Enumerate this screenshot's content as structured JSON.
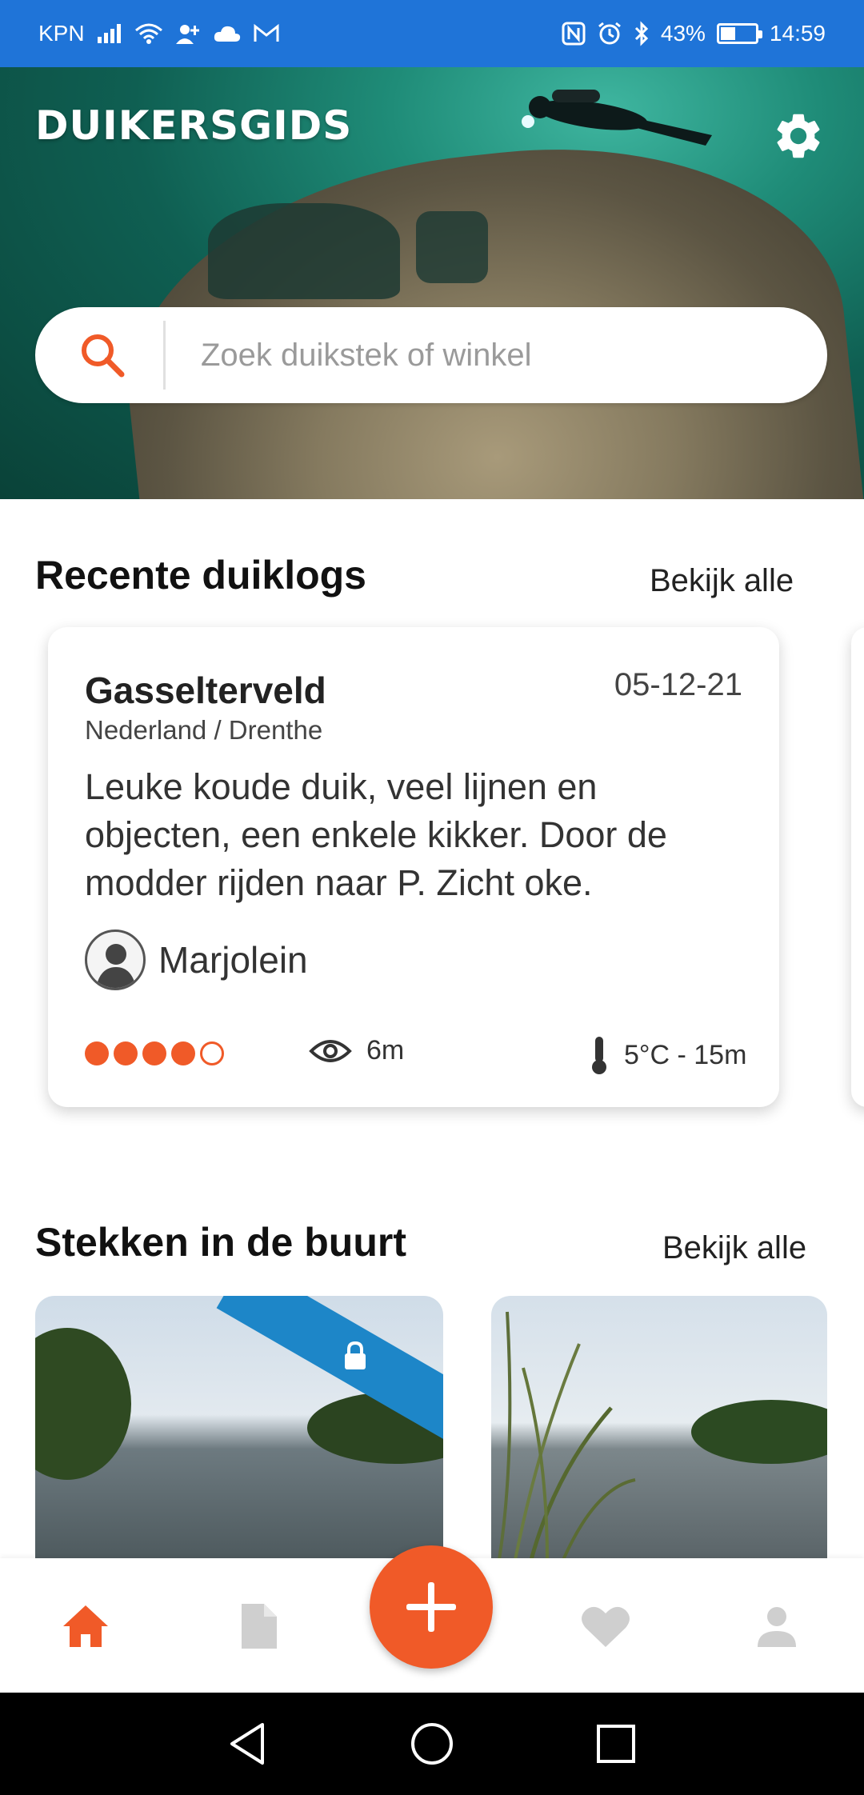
{
  "status_bar": {
    "carrier": "KPN",
    "battery_percent": "43%",
    "battery_level": 0.43,
    "time": "14:59"
  },
  "hero": {
    "brand": "DUIKERSGIDS",
    "search_placeholder": "Zoek duikstek of winkel"
  },
  "recent_logs": {
    "title": "Recente duiklogs",
    "view_all": "Bekijk alle",
    "card": {
      "site": "Gasselterveld",
      "date": "05-12-21",
      "location": "Nederland / Drenthe",
      "text": "Leuke koude duik, veel lijnen en objecten, een enkele kikker. Door de modder rijden naar P. Zicht oke.",
      "user": "Marjolein",
      "rating": 4,
      "rating_max": 5,
      "visibility": "6m",
      "temperature_depth": "5°C - 15m"
    }
  },
  "nearby": {
    "title": "Stekken in de buurt",
    "view_all": "Bekijk alle"
  },
  "colors": {
    "accent": "#f05a28",
    "status_bar": "#1f74d8",
    "ribbon": "#1d86c8"
  },
  "icons": {
    "nav": [
      "home-icon",
      "document-icon",
      "add-icon",
      "heart-icon",
      "person-icon"
    ]
  }
}
